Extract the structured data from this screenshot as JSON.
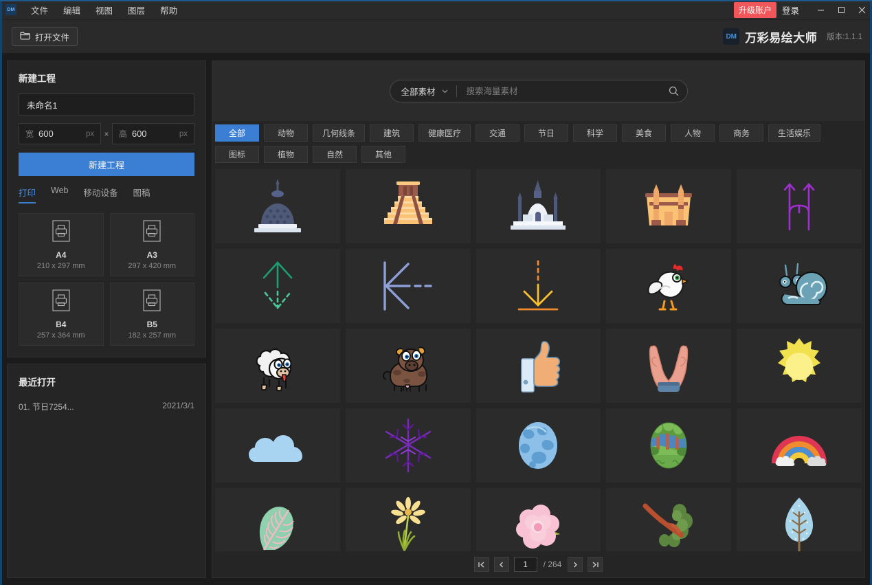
{
  "menubar": {
    "logo": "DM",
    "items": [
      {
        "label": "文件"
      },
      {
        "label": "编辑"
      },
      {
        "label": "视图"
      },
      {
        "label": "图层"
      },
      {
        "label": "帮助"
      }
    ],
    "upgrade_label": "升级账户",
    "login_label": "登录",
    "minimize": "—",
    "maximize": "▢",
    "close": "✕"
  },
  "toolbar": {
    "open_file_label": "打开文件",
    "brand_badge": "DM",
    "brand_name": "万彩易绘大师",
    "version": "版本:1.1.1"
  },
  "sidebar": {
    "new_project": {
      "title": "新建工程",
      "name_value": "未命名1",
      "name_placeholder": "未命名1",
      "width_label": "宽",
      "width_value": "600",
      "height_label": "高",
      "height_value": "600",
      "unit": "px",
      "multiply": "×",
      "create_button": "新建工程"
    },
    "tabs": [
      {
        "label": "打印",
        "active": true
      },
      {
        "label": "Web",
        "active": false
      },
      {
        "label": "移动设备",
        "active": false
      },
      {
        "label": "图稿",
        "active": false
      }
    ],
    "paper_sizes": [
      {
        "name": "A4",
        "dims": "210 x 297 mm"
      },
      {
        "name": "A3",
        "dims": "297 x 420 mm"
      },
      {
        "name": "B4",
        "dims": "257 x 364 mm"
      },
      {
        "name": "B5",
        "dims": "182 x 257 mm"
      }
    ],
    "recent": {
      "title": "最近打开",
      "items": [
        {
          "name": "01. 节日7254...",
          "date": "2021/3/1"
        }
      ]
    }
  },
  "main": {
    "search": {
      "category_label": "全部素材",
      "placeholder": "搜索海量素材",
      "value": ""
    },
    "categories": [
      {
        "label": "全部",
        "active": true
      },
      {
        "label": "动物",
        "active": false
      },
      {
        "label": "几何线条",
        "active": false
      },
      {
        "label": "建筑",
        "active": false
      },
      {
        "label": "健康医疗",
        "active": false
      },
      {
        "label": "交通",
        "active": false
      },
      {
        "label": "节日",
        "active": false
      },
      {
        "label": "科学",
        "active": false
      },
      {
        "label": "美食",
        "active": false
      },
      {
        "label": "人物",
        "active": false
      },
      {
        "label": "商务",
        "active": false
      },
      {
        "label": "生活娱乐",
        "active": false
      },
      {
        "label": "图标",
        "active": false
      },
      {
        "label": "植物",
        "active": false
      },
      {
        "label": "自然",
        "active": false
      },
      {
        "label": "其他",
        "active": false
      }
    ],
    "assets": [
      {
        "name": "stupa-temple"
      },
      {
        "name": "mayan-pyramid"
      },
      {
        "name": "taj-mahal"
      },
      {
        "name": "egyptian-temple"
      },
      {
        "name": "split-arrow-up-purple"
      },
      {
        "name": "arrow-up-dashed-green"
      },
      {
        "name": "arrow-left-dashed-blue"
      },
      {
        "name": "arrow-down-dashed-orange"
      },
      {
        "name": "chicken"
      },
      {
        "name": "snail"
      },
      {
        "name": "sheep"
      },
      {
        "name": "cow"
      },
      {
        "name": "thumbs-up"
      },
      {
        "name": "cupped-hands"
      },
      {
        "name": "sun"
      },
      {
        "name": "cloud"
      },
      {
        "name": "snowflake"
      },
      {
        "name": "planet-earth"
      },
      {
        "name": "forest-globe"
      },
      {
        "name": "rainbow"
      },
      {
        "name": "leaf-veined"
      },
      {
        "name": "daisy-flower"
      },
      {
        "name": "pink-rose"
      },
      {
        "name": "tree-branch"
      },
      {
        "name": "blue-leaf-tree"
      }
    ],
    "pager": {
      "first": "|◀",
      "prev": "‹",
      "page": "1",
      "total": "/ 264",
      "next": "›",
      "last": "▶|"
    }
  },
  "colors": {
    "accent": "#3b7fd4",
    "upgrade": "#f1575a",
    "panel": "#252525",
    "thumb_bg": "#2b2b2b"
  }
}
